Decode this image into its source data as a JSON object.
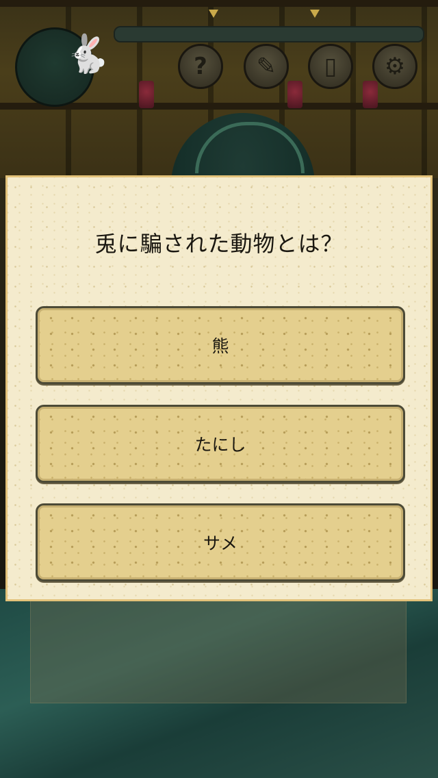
{
  "quiz": {
    "question": "兎に騙された動物とは？",
    "answers": [
      "熊",
      "たにし",
      "サメ"
    ]
  },
  "hud": {
    "buttons": [
      {
        "name": "help",
        "glyph": "?"
      },
      {
        "name": "edit",
        "glyph": "✎"
      },
      {
        "name": "phone",
        "glyph": "▯"
      },
      {
        "name": "settings",
        "glyph": "⚙"
      }
    ],
    "portrait_icon": "rabbit-icon"
  },
  "colors": {
    "panel_bg": "#f4ebcd",
    "panel_border": "#e3c27a",
    "answer_bg": "#e4cf8e",
    "answer_border": "#4c4a36",
    "text": "#1a1710"
  }
}
